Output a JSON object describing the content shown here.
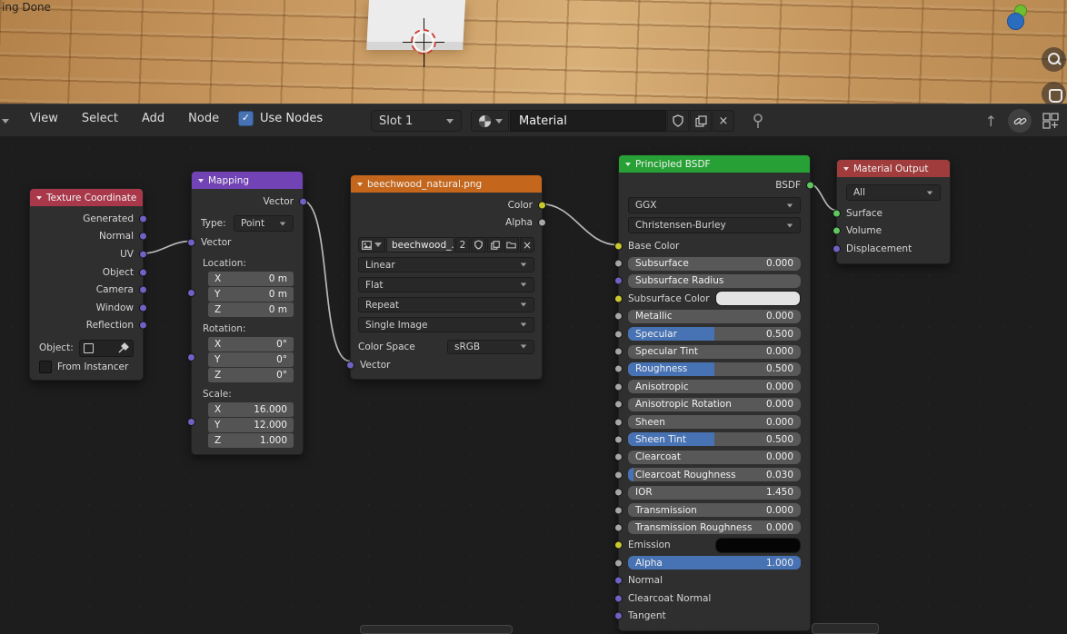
{
  "icons": {
    "check": "✓",
    "close": "×"
  },
  "viewport": {
    "status_text": "ing Done"
  },
  "header": {
    "menus": [
      {
        "label": "View"
      },
      {
        "label": "Select"
      },
      {
        "label": "Add"
      },
      {
        "label": "Node"
      }
    ],
    "use_nodes": {
      "label": "Use Nodes",
      "checked": true
    },
    "slot": {
      "value": "Slot 1"
    },
    "material": {
      "name": "Material"
    }
  },
  "editor": {
    "links": [
      {
        "from": "Texture Coordinate.UV",
        "to": "Mapping.Vector"
      },
      {
        "from": "Mapping.Vector",
        "to": "beechwood_natural.png.Vector"
      },
      {
        "from": "beechwood_natural.png.Color",
        "to": "Principled BSDF.Base Color"
      },
      {
        "from": "Principled BSDF.BSDF",
        "to": "Material Output.Surface"
      }
    ],
    "nodes": {
      "texture_coordinate": {
        "title": "Texture Coordinate",
        "outputs": [
          {
            "label": "Generated",
            "socket": "vector"
          },
          {
            "label": "Normal",
            "socket": "vector"
          },
          {
            "label": "UV",
            "socket": "vector"
          },
          {
            "label": "Object",
            "socket": "vector"
          },
          {
            "label": "Camera",
            "socket": "vector"
          },
          {
            "label": "Window",
            "socket": "vector"
          },
          {
            "label": "Reflection",
            "socket": "vector"
          }
        ],
        "object_label": "Object:",
        "from_instancer": {
          "label": "From Instancer",
          "checked": false
        }
      },
      "mapping": {
        "title": "Mapping",
        "output_label": "Vector",
        "type_label": "Type:",
        "type_value": "Point",
        "vector_input_label": "Vector",
        "groups": [
          {
            "label": "Location:",
            "rows": [
              {
                "axis": "X",
                "value": "0 m"
              },
              {
                "axis": "Y",
                "value": "0 m"
              },
              {
                "axis": "Z",
                "value": "0 m"
              }
            ]
          },
          {
            "label": "Rotation:",
            "rows": [
              {
                "axis": "X",
                "value": "0°"
              },
              {
                "axis": "Y",
                "value": "0°"
              },
              {
                "axis": "Z",
                "value": "0°"
              }
            ]
          },
          {
            "label": "Scale:",
            "rows": [
              {
                "axis": "X",
                "value": "16.000"
              },
              {
                "axis": "Y",
                "value": "12.000"
              },
              {
                "axis": "Z",
                "value": "1.000"
              }
            ]
          }
        ]
      },
      "image_texture": {
        "title": "beechwood_natural.png",
        "outputs": [
          {
            "label": "Color",
            "socket": "color"
          },
          {
            "label": "Alpha",
            "socket": "float"
          }
        ],
        "image_name": "beechwood_...",
        "users": "2",
        "dropdowns": [
          {
            "value": "Linear"
          },
          {
            "value": "Flat"
          },
          {
            "value": "Repeat"
          },
          {
            "value": "Single Image"
          }
        ],
        "color_space_label": "Color Space",
        "color_space_value": "sRGB",
        "vector_input_label": "Vector"
      },
      "principled": {
        "title": "Principled BSDF",
        "output_label": "BSDF",
        "dropdowns": [
          {
            "value": "GGX"
          },
          {
            "value": "Christensen-Burley"
          }
        ],
        "rows": [
          {
            "label": "Base Color",
            "widget": "plain",
            "socket": "color"
          },
          {
            "label": "Subsurface",
            "value": "0.000",
            "widget": "number",
            "fill": 0,
            "socket": "float"
          },
          {
            "label": "Subsurface Radius",
            "widget": "field",
            "socket": "vector"
          },
          {
            "label": "Subsurface Color",
            "widget": "color",
            "swatch": "#e3e3e3",
            "socket": "color"
          },
          {
            "label": "Metallic",
            "value": "0.000",
            "widget": "number",
            "fill": 0,
            "socket": "float"
          },
          {
            "label": "Specular",
            "value": "0.500",
            "widget": "slider",
            "fill": 0.5,
            "socket": "float"
          },
          {
            "label": "Specular Tint",
            "value": "0.000",
            "widget": "number",
            "fill": 0,
            "socket": "float"
          },
          {
            "label": "Roughness",
            "value": "0.500",
            "widget": "slider",
            "fill": 0.5,
            "socket": "float"
          },
          {
            "label": "Anisotropic",
            "value": "0.000",
            "widget": "number",
            "fill": 0,
            "socket": "float"
          },
          {
            "label": "Anisotropic Rotation",
            "value": "0.000",
            "widget": "number",
            "fill": 0,
            "socket": "float"
          },
          {
            "label": "Sheen",
            "value": "0.000",
            "widget": "number",
            "fill": 0,
            "socket": "float"
          },
          {
            "label": "Sheen Tint",
            "value": "0.500",
            "widget": "slider",
            "fill": 0.5,
            "socket": "float"
          },
          {
            "label": "Clearcoat",
            "value": "0.000",
            "widget": "number",
            "fill": 0,
            "socket": "float"
          },
          {
            "label": "Clearcoat Roughness",
            "value": "0.030",
            "widget": "slider",
            "fill": 0.03,
            "socket": "float"
          },
          {
            "label": "IOR",
            "value": "1.450",
            "widget": "number",
            "fill": 0,
            "socket": "float"
          },
          {
            "label": "Transmission",
            "value": "0.000",
            "widget": "number",
            "fill": 0,
            "socket": "float"
          },
          {
            "label": "Transmission Roughness",
            "value": "0.000",
            "widget": "number",
            "fill": 0,
            "socket": "float"
          },
          {
            "label": "Emission",
            "widget": "color",
            "swatch": "#050505",
            "socket": "color"
          },
          {
            "label": "Alpha",
            "value": "1.000",
            "widget": "slider",
            "fill": 1,
            "socket": "float"
          },
          {
            "label": "Normal",
            "widget": "plain",
            "socket": "vector"
          },
          {
            "label": "Clearcoat Normal",
            "widget": "plain",
            "socket": "vector"
          },
          {
            "label": "Tangent",
            "widget": "plain",
            "socket": "vector"
          }
        ]
      },
      "material_output": {
        "title": "Material Output",
        "target_value": "All",
        "inputs": [
          {
            "label": "Surface",
            "socket": "shader"
          },
          {
            "label": "Volume",
            "socket": "shader"
          },
          {
            "label": "Displacement",
            "socket": "vector"
          }
        ]
      }
    }
  }
}
